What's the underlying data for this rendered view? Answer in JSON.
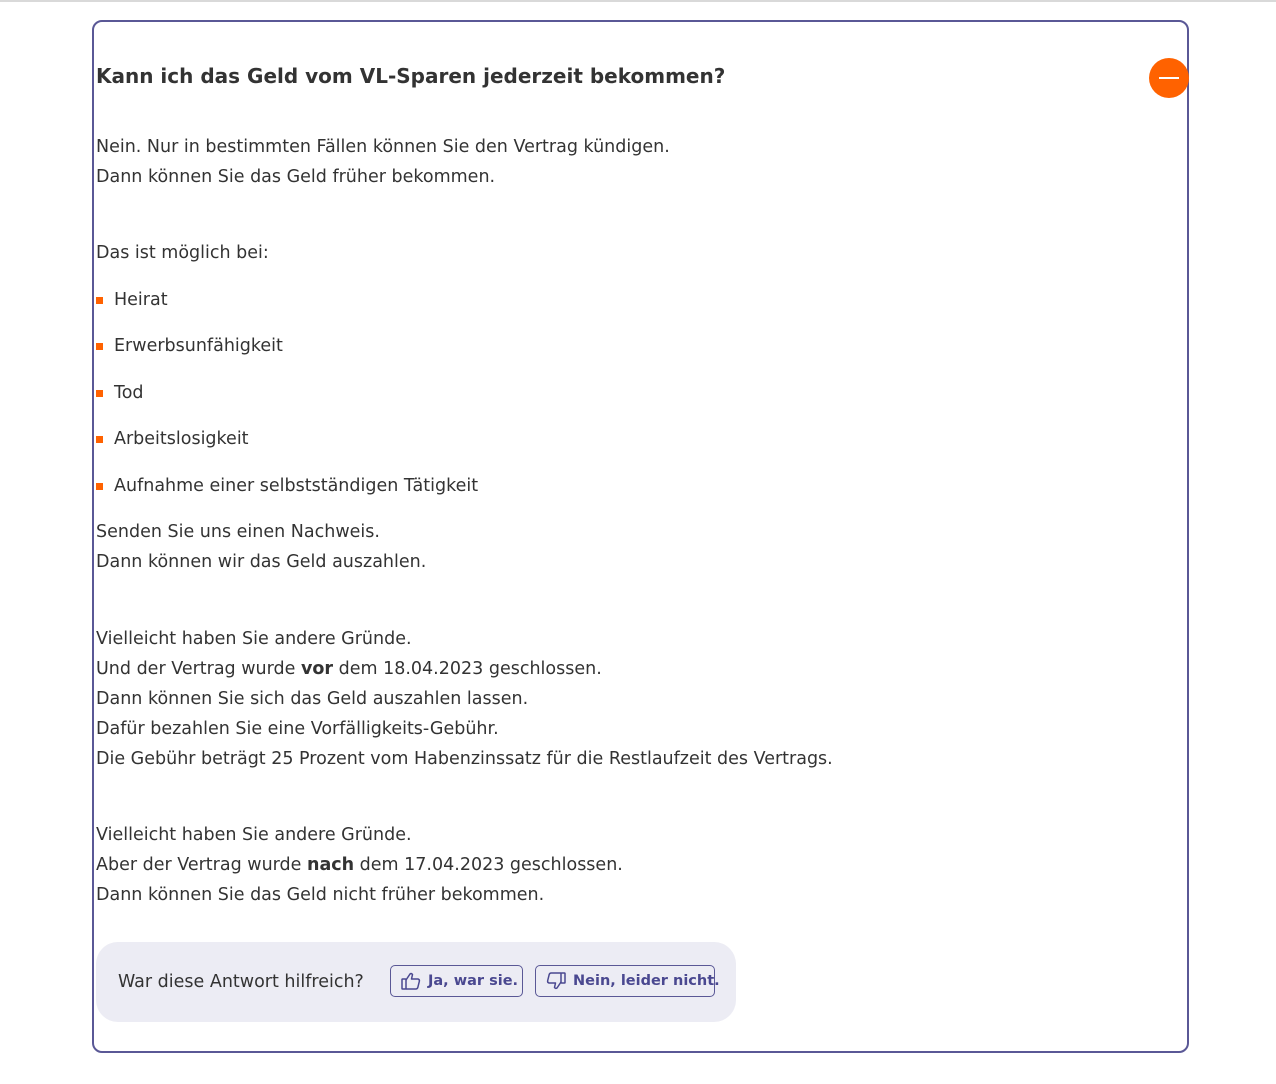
{
  "faq": {
    "question": "Kann ich das Geld vom VL-Sparen jederzeit bekommen?",
    "intro_line1": "Nein. Nur in bestimmten Fällen können Sie den Vertrag kündigen.",
    "intro_line2": "Dann können Sie das Geld früher bekommen.",
    "possible_label": "Das ist möglich bei:",
    "cases": [
      "Heirat",
      "Erwerbsunfähigkeit",
      "Tod",
      "Arbeitslosigkeit",
      "Aufnahme einer selbstständigen Tätigkeit"
    ],
    "proof_line1": "Senden Sie uns einen Nachweis.",
    "proof_line2": "Dann können wir das Geld auszahlen.",
    "before": {
      "line1": "Vielleicht haben Sie andere Gründe.",
      "line2_pre": "Und der Vertrag wurde ",
      "line2_bold": "vor",
      "line2_post": " dem 18.04.2023 geschlossen.",
      "line3": "Dann können Sie sich das Geld auszahlen lassen.",
      "line4": "Dafür bezahlen Sie eine Vorfälligkeits-Gebühr.",
      "line5": "Die Gebühr beträgt 25 Prozent vom Habenzinssatz für die Restlaufzeit des Vertrags."
    },
    "after": {
      "line1": "Vielleicht haben Sie andere Gründe.",
      "line2_pre": "Aber der Vertrag wurde ",
      "line2_bold": "nach",
      "line2_post": " dem 17.04.2023 geschlossen.",
      "line3": "Dann können Sie das Geld nicht früher bekommen."
    }
  },
  "feedback": {
    "question": "War diese Antwort hilfreich?",
    "yes_label": "Ja, war sie.",
    "no_label": "Nein, leider nicht."
  },
  "icons": {
    "collapse": "minus-circle-icon",
    "thumbs_up": "thumbs-up-icon",
    "thumbs_down": "thumbs-down-icon"
  },
  "colors": {
    "accent": "#ff6200",
    "border": "#5a5896",
    "feedback_bg": "#ececf4",
    "button_text": "#4a4890"
  }
}
